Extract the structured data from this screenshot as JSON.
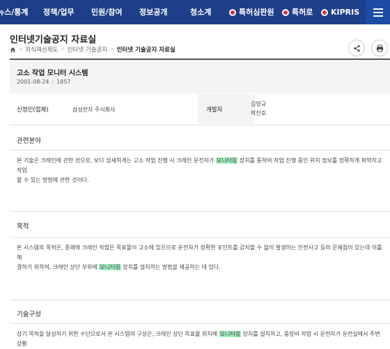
{
  "nav": {
    "items": [
      "뉴스/통계",
      "정책/업무",
      "민원/참여",
      "정보공개",
      "청소계"
    ],
    "external": [
      {
        "label": "특허심판원",
        "icon": "kipo-logo-icon"
      },
      {
        "label": "특허로",
        "icon": "kipo-logo-icon"
      },
      {
        "label": "KIPRIS",
        "icon": "kipo-logo-icon"
      }
    ]
  },
  "page": {
    "title": "인터넷기술공지 자료실",
    "breadcrumb": [
      "지식재산제도",
      "인터넷 기술공지",
      "인터넷 기술공지 자료실"
    ]
  },
  "doc": {
    "title": "고소 작업 모니터 시스템",
    "date": "2001-08-24",
    "views": "1857",
    "applicant_label": "신청인(업체)",
    "applicant": "삼성전자 주식회사",
    "developer_label": "개발자",
    "developers": [
      "김영규",
      "박진호"
    ]
  },
  "sections": {
    "field": {
      "heading": "관련분야",
      "line1_a": "본 기술은 크레인에 관한 것으로, 보다 상세하게는 고소 작업 진행 시 크레인 운전자가 ",
      "line1_hl": "모니터링",
      "line1_b": " 장치를 통하여 작업 진행 중인 위치 정보를 정확하게 파악하고 작업",
      "line2": "할 수 있는 방법에 관한 것이다."
    },
    "purpose": {
      "heading": "목적",
      "line1": "본 시스템의 목적은, 종래에 크레인 작업은 목표물이 고소에 있으므로 운전자가 정확한 포인트를 감지할 수 없이 발생하는 안전사고 등의 문제점이 있는데 이를 해",
      "line2_a": "결하기 위하여, 크레인 상단 부위에 ",
      "line2_hl": "모니터링",
      "line2_b": " 장치를 설치하는 방법을 제공하는 데 있다."
    },
    "composition": {
      "heading": "기술구성",
      "line1_a": "상기 목적을 달성하기 위한 수단으로서 본 시스템의 구성은, 크레인 상단 목표물 위치에 ",
      "line1_hl": "모니터링",
      "line1_b": " 장치를 설치하고, 중장비 작업 시 운전자가 운전실에서 주변 상황"
    }
  }
}
